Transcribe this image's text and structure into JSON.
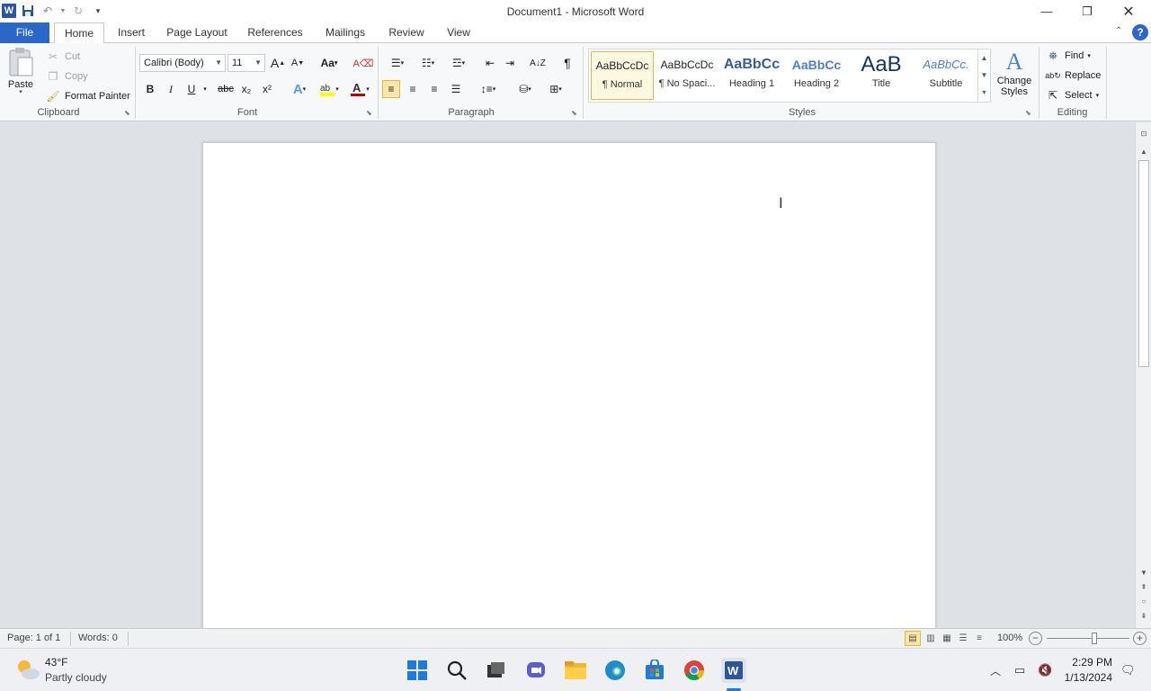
{
  "window": {
    "title": "Document1  -  Microsoft Word",
    "app_icon": "W",
    "controls": [
      "minimize-icon",
      "restore-icon",
      "close-icon"
    ]
  },
  "qat": {
    "save": "save-icon",
    "undo": "undo-icon",
    "redo": "redo-icon",
    "customize": "customize-qat-icon"
  },
  "tabs": [
    {
      "label": "File"
    },
    {
      "label": "Home"
    },
    {
      "label": "Insert"
    },
    {
      "label": "Page Layout"
    },
    {
      "label": "References"
    },
    {
      "label": "Mailings"
    },
    {
      "label": "Review"
    },
    {
      "label": "View"
    }
  ],
  "clipboard": {
    "paste": "Paste",
    "cut": "Cut",
    "copy": "Copy",
    "format_painter": "Format Painter",
    "group": "Clipboard"
  },
  "font": {
    "name": "Calibri (Body)",
    "size": "11",
    "group": "Font",
    "grow": "A",
    "shrink": "A",
    "case": "Aa",
    "bold": "B",
    "italic": "I",
    "underline": "U",
    "strike": "abc",
    "subscript": "x₂",
    "superscript": "x²",
    "color_letter": "A",
    "color_highlight": "#ffff00",
    "color_font": "#c00000"
  },
  "paragraph": {
    "group": "Paragraph",
    "pilcrow": "¶"
  },
  "styles": {
    "group": "Styles",
    "items": [
      {
        "preview": "AaBbCcDc",
        "name": "¶ Normal"
      },
      {
        "preview": "AaBbCcDc",
        "name": "¶ No Spaci..."
      },
      {
        "preview": "AaBbCc",
        "name": "Heading 1"
      },
      {
        "preview": "AaBbCc",
        "name": "Heading 2"
      },
      {
        "preview": "AaB",
        "name": "Title"
      },
      {
        "preview": "AaBbCc.",
        "name": "Subtitle"
      }
    ],
    "change": "Change Styles"
  },
  "editing": {
    "group": "Editing",
    "find": "Find",
    "replace": "Replace",
    "select": "Select"
  },
  "status": {
    "page": "Page: 1 of 1",
    "words": "Words: 0",
    "zoom": "100%",
    "zoom_level": 1.0
  },
  "taskbar": {
    "weather_temp": "43°F",
    "weather_desc": "Partly cloudy",
    "time": "2:29 PM",
    "date": "1/13/2024",
    "apps": [
      "start-icon",
      "search-icon",
      "task-view-icon",
      "chat-icon",
      "file-explorer-icon",
      "edge-icon",
      "store-icon",
      "chrome-icon",
      "word-icon"
    ]
  }
}
